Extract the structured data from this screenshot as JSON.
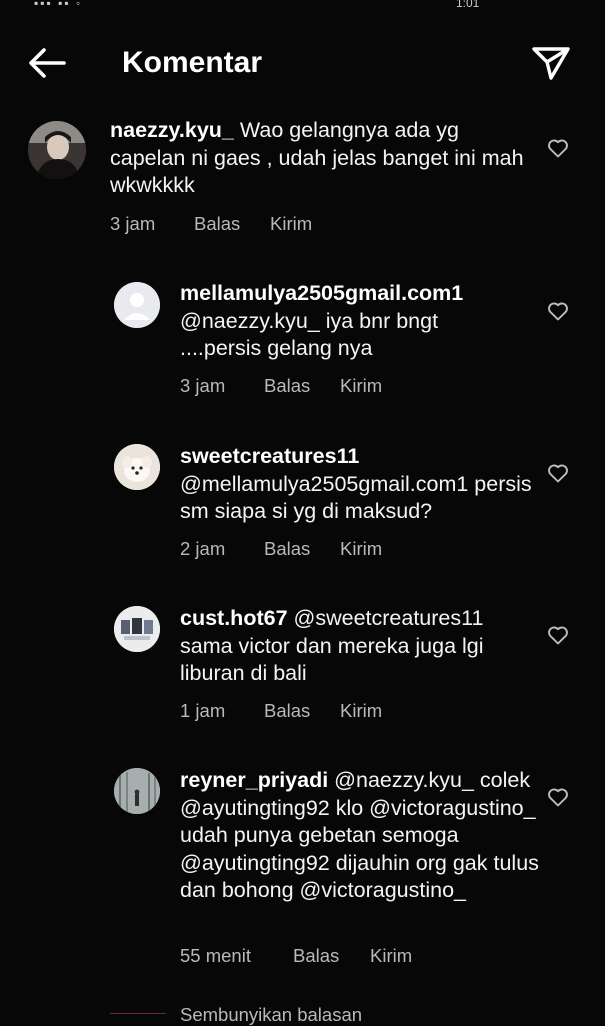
{
  "status_bar": {
    "left": "▪▪▪ ▪▪ ◦",
    "right": "1:01"
  },
  "header": {
    "title": "Komentar",
    "back_icon": "arrow-left-icon",
    "send_icon": "paper-plane-icon"
  },
  "comments": [
    {
      "username": "naezzy.kyu_",
      "text": " Wao gelangnya ada yg capelan ni gaes , udah jelas banget ini mah wkwkkkk",
      "time": "3 jam",
      "reply": "Balas",
      "send": "Kirim",
      "avatar": "person-photo-avatar"
    },
    {
      "username": "mellamulya2505gmail.com1",
      "text": "@naezzy.kyu_ iya bnr bngt ....persis gelang nya",
      "time": "3 jam",
      "reply": "Balas",
      "send": "Kirim",
      "avatar": "default-user-avatar"
    },
    {
      "username": "sweetcreatures11",
      "text": "@mellamulya2505gmail.com1 persis sm siapa si yg di maksud?",
      "time": "2 jam",
      "reply": "Balas",
      "send": "Kirim",
      "avatar": "white-dog-avatar"
    },
    {
      "username": "cust.hot67",
      "text": " @sweetcreatures11 sama victor dan mereka juga lgi liburan di bali",
      "time": "1 jam",
      "reply": "Balas",
      "send": "Kirim",
      "avatar": "collage-avatar"
    },
    {
      "username": "reyner_priyadi",
      "text": " @naezzy.kyu_ colek @ayutingting92 klo @victoragustino_ udah punya gebetan semoga @ayutingting92 dijauhin org gak tulus dan bohong @victoragustino_",
      "time": "55 menit",
      "reply": "Balas",
      "send": "Kirim",
      "avatar": "misty-forest-avatar"
    }
  ],
  "hide_replies": "Sembunyikan balasan",
  "colors": {
    "background": "#070707",
    "text": "#f4f4f4",
    "muted": "#b9b9b9"
  }
}
